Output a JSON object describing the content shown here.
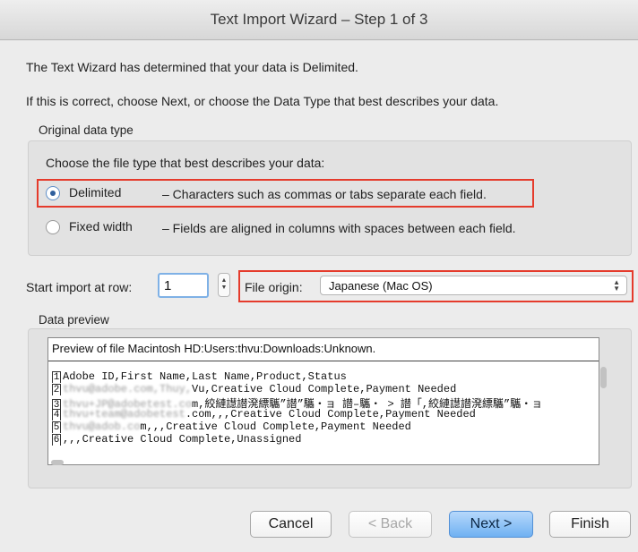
{
  "window": {
    "title": "Text Import Wizard – Step 1 of 3"
  },
  "intro": {
    "line1": "The Text Wizard has determined that your data is Delimited.",
    "line2": "If this is correct, choose Next, or choose the Data Type that best describes your data."
  },
  "data_type": {
    "group_label": "Original data type",
    "prompt": "Choose the file type that best describes your data:",
    "options": [
      {
        "label": "Delimited",
        "description": "– Characters such as commas or tabs separate each field.",
        "selected": true
      },
      {
        "label": "Fixed width",
        "description": "– Fields are aligned in columns with spaces between each field.",
        "selected": false
      }
    ]
  },
  "import_row": {
    "label": "Start import at row:",
    "value": "1"
  },
  "file_origin": {
    "label": "File origin:",
    "value": "Japanese (Mac OS)"
  },
  "preview": {
    "group_label": "Data preview",
    "header": "Preview of file Macintosh HD:Users:thvu:Downloads:Unknown.",
    "lines": [
      {
        "num": "1",
        "hidden": "",
        "text": "Adobe ID,First Name,Last Name,Product,Status"
      },
      {
        "num": "2",
        "hidden": "thvu@adobe.com,Thuy,",
        "text": "Vu,Creative Cloud Complete,Payment Needed"
      },
      {
        "num": "3",
        "hidden": "thvu+JP@adobetest.co",
        "text": "m,絞縺譿譛溌縹驨”譛”驨・ョ 譛–驨・ > 譛「,絞縺譿譛溌縹驨”驨・ョ"
      },
      {
        "num": "4",
        "hidden": "thvu+team@adobetest",
        "text": ".com,,,Creative Cloud Complete,Payment Needed"
      },
      {
        "num": "5",
        "hidden": "thvu@adob.co",
        "text": "m,,,Creative Cloud Complete,Payment Needed"
      },
      {
        "num": "6",
        "hidden": "",
        "text": ",,,Creative Cloud Complete,Unassigned"
      }
    ]
  },
  "buttons": {
    "cancel": "Cancel",
    "back": "< Back",
    "next": "Next >",
    "finish": "Finish"
  },
  "colors": {
    "highlight": "#e53b2c",
    "default_button": "#6fb1f2"
  }
}
